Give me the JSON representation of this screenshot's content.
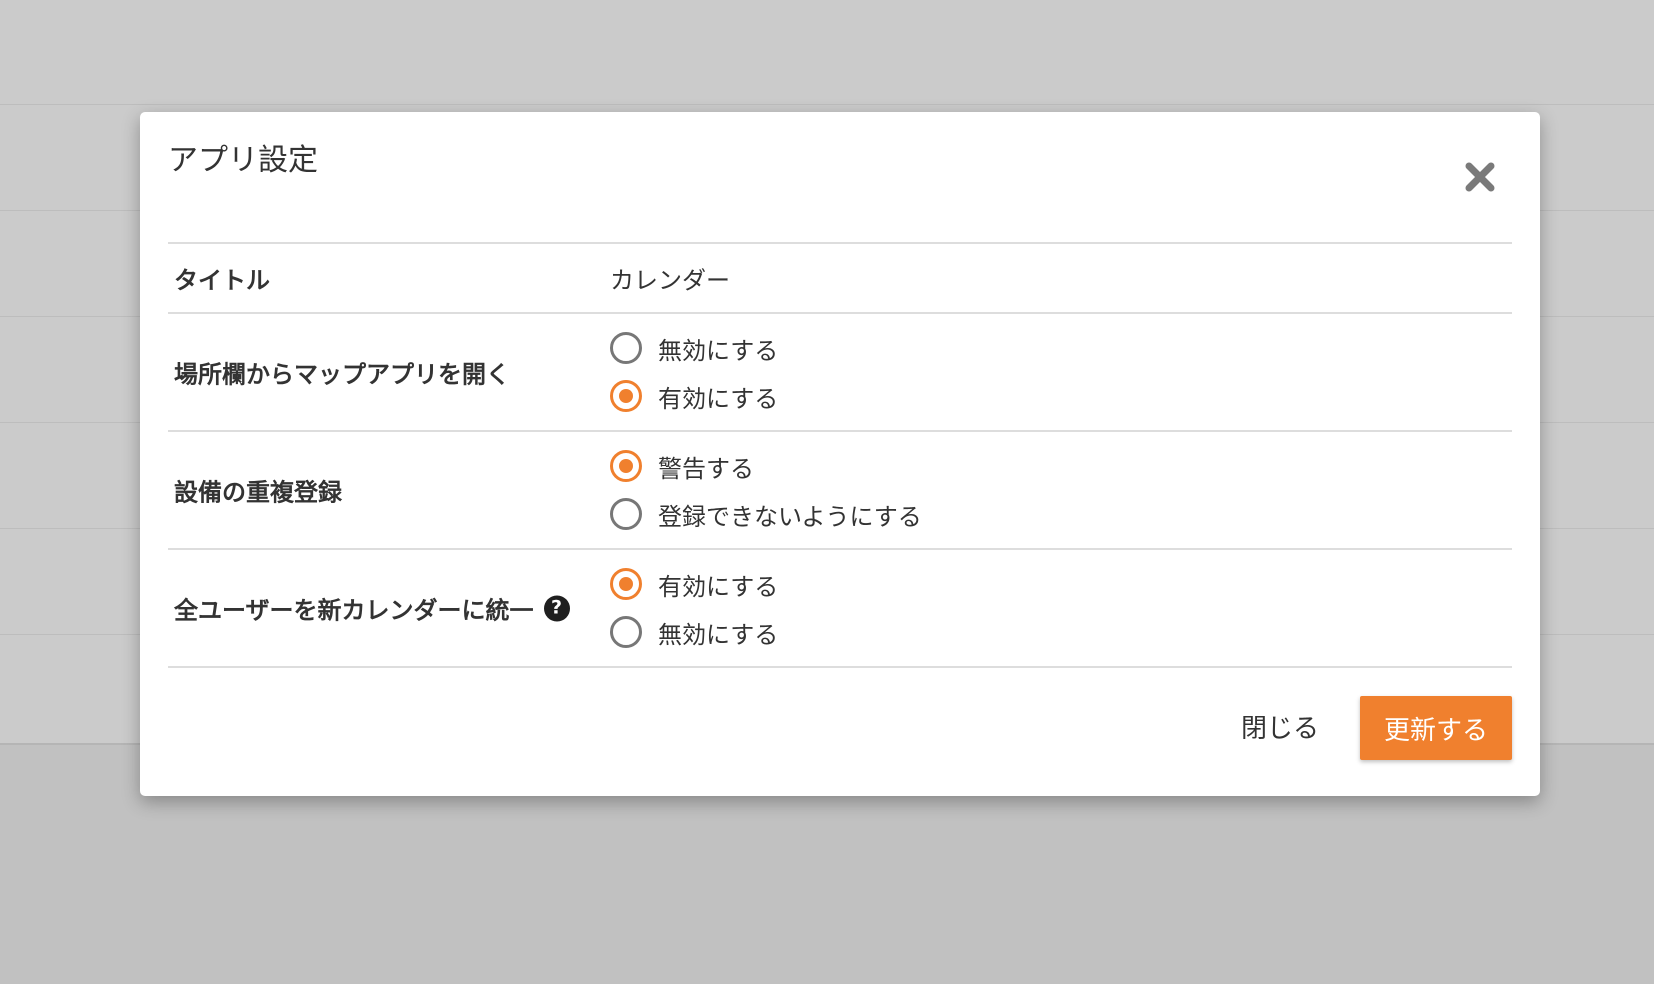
{
  "dialog": {
    "title": "アプリ設定",
    "close_icon": "close-x-icon"
  },
  "settings": {
    "title_row": {
      "label": "タイトル",
      "value": "カレンダー"
    },
    "map_open": {
      "label": "場所欄からマップアプリを開く",
      "options": [
        {
          "label": "無効にする",
          "checked": false
        },
        {
          "label": "有効にする",
          "checked": true
        }
      ]
    },
    "duplicate_booking": {
      "label": "設備の重複登録",
      "options": [
        {
          "label": "警告する",
          "checked": true
        },
        {
          "label": "登録できないようにする",
          "checked": false
        }
      ]
    },
    "unify_calendar": {
      "label": "全ユーザーを新カレンダーに統一",
      "help_icon": "question-circle-icon",
      "options": [
        {
          "label": "有効にする",
          "checked": true
        },
        {
          "label": "無効にする",
          "checked": false
        }
      ]
    }
  },
  "footer": {
    "close_label": "閉じる",
    "update_label": "更新する"
  },
  "colors": {
    "accent": "#f0802e",
    "overlay": "#cbcbcb",
    "divider": "#dddddd"
  }
}
